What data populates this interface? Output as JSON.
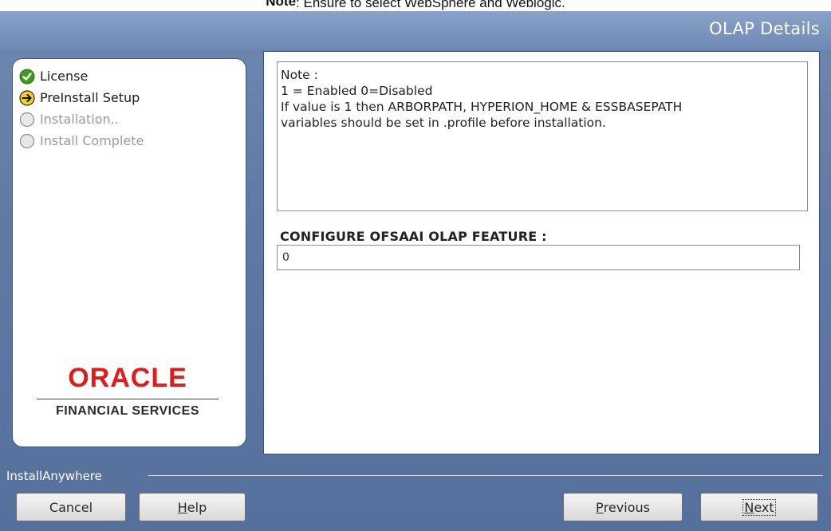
{
  "doc_note": {
    "bold": "Note",
    "text": ": Ensure to select WebSphere and Weblogic."
  },
  "window": {
    "title": "OLAP Details"
  },
  "steps": [
    {
      "label": "License",
      "state": "done",
      "icon": "check-icon"
    },
    {
      "label": "PreInstall Setup",
      "state": "current",
      "icon": "arrow-right-icon"
    },
    {
      "label": "Installation..",
      "state": "pending",
      "icon": "empty-circle-icon"
    },
    {
      "label": "Install Complete",
      "state": "pending",
      "icon": "empty-circle-icon"
    }
  ],
  "logo": {
    "brand": "ORACLE",
    "subtitle": "FINANCIAL SERVICES"
  },
  "note": {
    "lines": [
      "Note :",
      "1 = Enabled 0=Disabled",
      "If value is 1 then ARBORPATH, HYPERION_HOME & ESSBASEPATH",
      "variables should be set in .profile before installation."
    ]
  },
  "config": {
    "label": "CONFIGURE OFSAAI OLAP FEATURE :",
    "value": "0"
  },
  "footer": {
    "brand": "InstallAnywhere",
    "cancel_label": "Cancel",
    "help": {
      "mnemonic": "H",
      "rest": "elp"
    },
    "previous": {
      "mnemonic": "P",
      "rest": "revious"
    },
    "next": {
      "mnemonic": "N",
      "rest": "ext"
    }
  },
  "colors": {
    "window_blue": "#6f88b0",
    "oracle_red": "#e11a1a",
    "check_green": "#3d9b1f",
    "arrow_yellow": "#f2d022"
  }
}
